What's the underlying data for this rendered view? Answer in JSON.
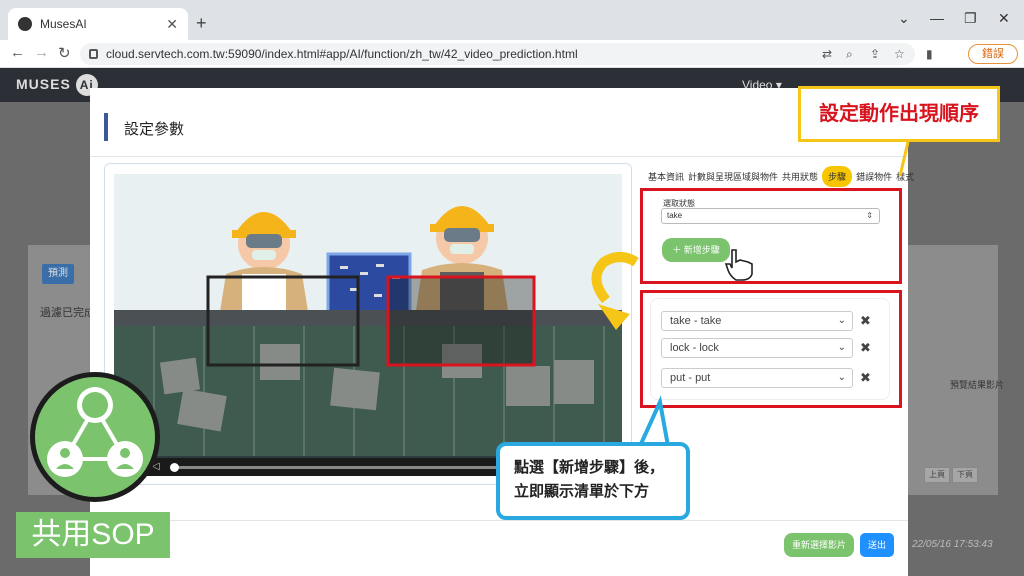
{
  "browser": {
    "tab_title": "MusesAI",
    "url": "cloud.servtech.com.tw:59090/index.html#app/AI/function/zh_tw/42_video_prediction.html",
    "error_button": "錯誤"
  },
  "app": {
    "logo_text": "MUSES",
    "logo_ai": "Ai",
    "video_menu": "Video",
    "bg_button": "預測",
    "bg_text": "過濾已完成",
    "bg_column_right": "預覽結果影片",
    "bg_prev": "上頁",
    "bg_next": "下頁",
    "bg_time": "22/05/16 17:53:43"
  },
  "modal": {
    "title": "設定參數",
    "tabs": [
      "基本資訊",
      "計數與呈現區域與物件",
      "共用狀態",
      "步驟",
      "錯誤物件",
      "樣式"
    ],
    "state_label": "選取狀態",
    "state_value": "take",
    "add_step_button": "新增步驟",
    "steps": [
      {
        "label": "take - take"
      },
      {
        "label": "lock - lock"
      },
      {
        "label": "put - put"
      }
    ],
    "reselect_button": "重新選擇影片",
    "send_button": "送出"
  },
  "annotations": {
    "top_callout": "設定動作出現順序",
    "bubble_line1": "點選【新增步驟】後，",
    "bubble_line2": "立即顯示清單於下方",
    "sop_label": "共用SOP"
  },
  "colors": {
    "accent_red": "#d9141e",
    "accent_yellow": "#f5c518",
    "accent_green": "#7cc36e",
    "accent_blue": "#29a9e0"
  }
}
